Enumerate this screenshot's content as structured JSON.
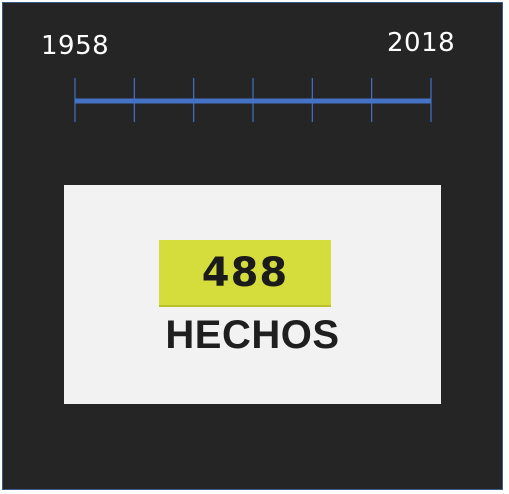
{
  "timeline": {
    "start_year": "1958",
    "end_year": "2018",
    "line_color": "#4472c4",
    "tick_color": "#4472c4",
    "tick_count": 7
  },
  "card": {
    "count": "488",
    "label": "HECHOS",
    "badge_color": "#d4dd3c",
    "background_color": "#f3f2f2"
  },
  "frame": {
    "background_color": "#252525",
    "border_color": "#3b5a8c"
  }
}
